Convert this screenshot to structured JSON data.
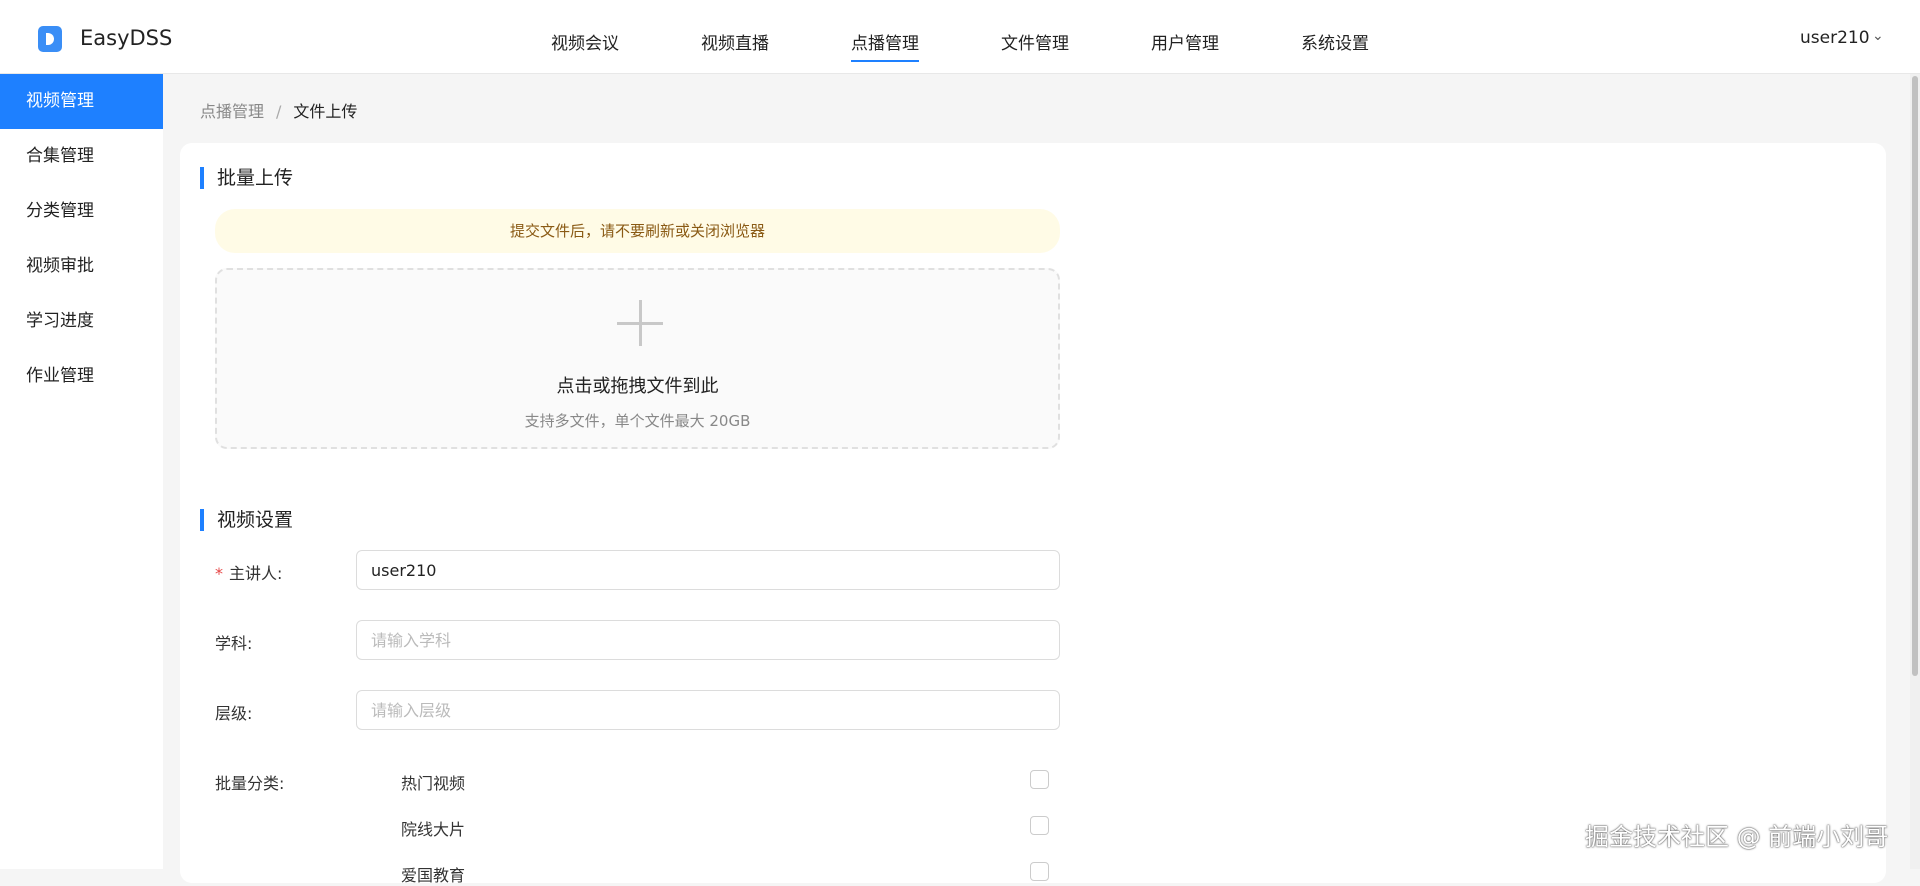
{
  "app": {
    "name": "EasyDSS"
  },
  "nav": [
    "视频会议",
    "视频直播",
    "点播管理",
    "文件管理",
    "用户管理",
    "系统设置"
  ],
  "nav_active": "点播管理",
  "user": {
    "name": "user210"
  },
  "sidebar": [
    "视频管理",
    "合集管理",
    "分类管理",
    "视频审批",
    "学习进度",
    "作业管理"
  ],
  "breadcrumb": {
    "parent": "点播管理",
    "sep": "/",
    "current": "文件上传"
  },
  "upload_section": {
    "title": "批量上传",
    "notice": "提交文件后，请不要刷新或关闭浏览器",
    "drop_text": "点击或拖拽文件到此",
    "drop_hint": "支持多文件，单个文件最大 20GB"
  },
  "settings": {
    "title": "视频设置",
    "presenter": {
      "label": "主讲人:",
      "required_mark": "*",
      "value": "user210"
    },
    "subject": {
      "label": "学科:",
      "placeholder": "请输入学科"
    },
    "level": {
      "label": "层级:",
      "placeholder": "请输入层级"
    },
    "category": {
      "label": "批量分类:",
      "options": [
        "热门视频",
        "院线大片",
        "爱国教育"
      ]
    }
  },
  "watermark": "掘金技术社区 @ 前端小刘哥",
  "colors": {
    "accent": "#1e80ff",
    "notice_bg": "#fffbe6",
    "notice_text": "#8a5a14"
  }
}
